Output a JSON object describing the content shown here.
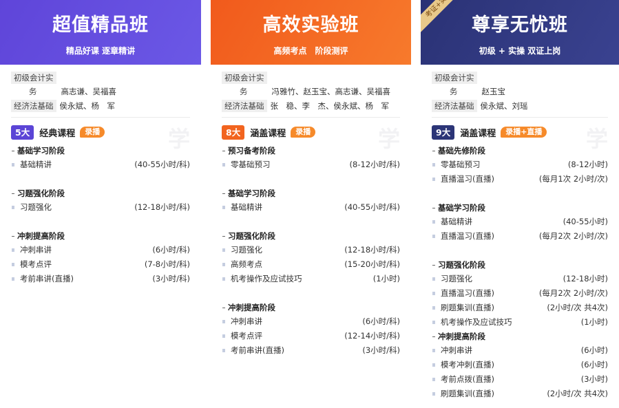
{
  "cards": [
    {
      "title": "超值精品班",
      "subtitle": "精品好课 逐章精讲",
      "teachers": [
        {
          "subject": "初级会计实",
          "names": ""
        },
        {
          "subject": "务",
          "names": "高志谦、吴福喜"
        },
        {
          "subject": "经济法基础",
          "names": "侯永斌、杨　军"
        }
      ],
      "count": "5大",
      "course_type": "经典课程",
      "badge": "录播",
      "watermark": "学",
      "stages": [
        {
          "title": "基础学习阶段",
          "items": [
            {
              "name": "基础精讲",
              "hours": "(40-55小时/科)"
            }
          ]
        },
        {
          "title": "习题强化阶段",
          "items": [
            {
              "name": "习题强化",
              "hours": "(12-18小时/科)"
            }
          ]
        },
        {
          "title": "冲刺提高阶段",
          "items": [
            {
              "name": "冲刺串讲",
              "hours": "(6小时/科)"
            },
            {
              "name": "模考点评",
              "hours": "(7-8小时/科)"
            },
            {
              "name": "考前串讲(直播)",
              "hours": "(3小时/科)"
            }
          ]
        }
      ]
    },
    {
      "title": "高效实验班",
      "subtitle": "高频考点　阶段测评",
      "teachers": [
        {
          "subject": "初级会计实",
          "names": ""
        },
        {
          "subject": "务",
          "names": "冯雅竹、赵玉宝、高志谦、吴福喜"
        },
        {
          "subject": "经济法基础",
          "names": "张　稳、李　杰、侯永斌、杨　军"
        }
      ],
      "count": "8大",
      "course_type": "涵盖课程",
      "badge": "录播",
      "watermark": "学",
      "stages": [
        {
          "title": "预习备考阶段",
          "items": [
            {
              "name": "零基础预习",
              "hours": "(8-12小时/科)"
            }
          ]
        },
        {
          "title": "基础学习阶段",
          "items": [
            {
              "name": "基础精讲",
              "hours": "(40-55小时/科)"
            }
          ]
        },
        {
          "title": "习题强化阶段",
          "items": [
            {
              "name": "习题强化",
              "hours": "(12-18小时/科)"
            },
            {
              "name": "高频考点",
              "hours": "(15-20小时/科)"
            },
            {
              "name": "机考操作及应试技巧",
              "hours": "(1小时)"
            }
          ]
        },
        {
          "title": "冲刺提高阶段",
          "items": [
            {
              "name": "冲刺串讲",
              "hours": "(6小时/科)"
            },
            {
              "name": "模考点评",
              "hours": "(12-14小时/科)"
            },
            {
              "name": "考前串讲(直播)",
              "hours": "(3小时/科)"
            }
          ]
        }
      ]
    },
    {
      "title": "尊享无忧班",
      "subtitle": "初级 + 实操 双证上岗",
      "ribbon": "考证+实",
      "teachers": [
        {
          "subject": "初级会计实",
          "names": ""
        },
        {
          "subject": "务",
          "names": "赵玉宝"
        },
        {
          "subject": "经济法基础",
          "names": "侯永斌、刘瑶"
        }
      ],
      "count": "9大",
      "course_type": "涵盖课程",
      "badge": "录播+直播",
      "watermark": "学",
      "stages": [
        {
          "title": "基础先修阶段",
          "items": [
            {
              "name": "零基础预习",
              "hours": "(8-12小时)"
            },
            {
              "name": "直播温习(直播)",
              "hours": "(每月1次 2小时/次)"
            }
          ]
        },
        {
          "title": "基础学习阶段",
          "items": [
            {
              "name": "基础精讲",
              "hours": "(40-55小时)"
            },
            {
              "name": "直播温习(直播)",
              "hours": "(每月2次 2小时/次)"
            }
          ]
        },
        {
          "title": "习题强化阶段",
          "items": [
            {
              "name": "习题强化",
              "hours": "(12-18小时)"
            },
            {
              "name": "直播温习(直播)",
              "hours": "(每月2次 2小时/次)"
            },
            {
              "name": "刷题集训(直播)",
              "hours": "(2小时/次 共4次)"
            },
            {
              "name": "机考操作及应试技巧",
              "hours": "(1小时)"
            }
          ]
        },
        {
          "title": "冲刺提高阶段",
          "items": [
            {
              "name": "冲刺串讲",
              "hours": "(6小时)"
            },
            {
              "name": "模考冲刺(直播)",
              "hours": "(6小时)"
            },
            {
              "name": "考前点拨(直播)",
              "hours": "(3小时)"
            },
            {
              "name": "刷题集训(直播)",
              "hours": "(2小时/次 共4次)"
            }
          ]
        }
      ]
    }
  ],
  "colors": {
    "card1_header": "#5f45d9",
    "card2_header": "#f15a1c",
    "card3_header": "#2a3275",
    "badge": "#f68a2a"
  }
}
